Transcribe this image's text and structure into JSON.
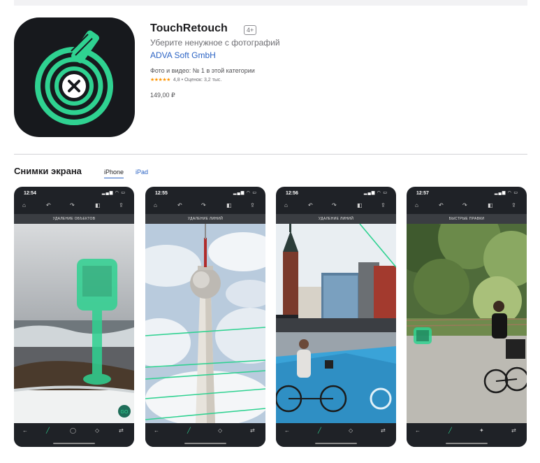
{
  "app": {
    "title": "TouchRetouch",
    "age_rating": "4+",
    "subtitle": "Уберите ненужное с фотографий",
    "developer": "ADVA Soft GmbH",
    "rank": "Фото и видео: № 1 в этой категории",
    "stars": "★★★★★",
    "rating_text": "4,8 • Оценок: 3,2 тыс.",
    "price": "149,00 ₽"
  },
  "screenshots": {
    "title": "Снимки экрана",
    "tabs": [
      "iPhone",
      "iPad"
    ],
    "items": [
      {
        "time": "12:54",
        "label": "УДАЛЕНИЕ ОБЪЕКТОВ"
      },
      {
        "time": "12:55",
        "label": "УДАЛЕНИЕ ЛИНИЙ"
      },
      {
        "time": "12:56",
        "label": "УДАЛЕНИЕ ЛИНИЙ"
      },
      {
        "time": "12:57",
        "label": "БЫСТРЫЕ ПРАВКИ"
      }
    ]
  },
  "colors": {
    "accent_link": "#2b63c4",
    "brand_green": "#2fd291",
    "icon_bg": "#17191d",
    "star": "#ff9500"
  },
  "icons": [
    "touchretouch-logo-icon",
    "home-icon",
    "undo-icon",
    "redo-icon",
    "compare-icon",
    "share-icon",
    "back-icon",
    "brush-icon",
    "lasso-icon",
    "eraser-icon",
    "settings-icon"
  ]
}
